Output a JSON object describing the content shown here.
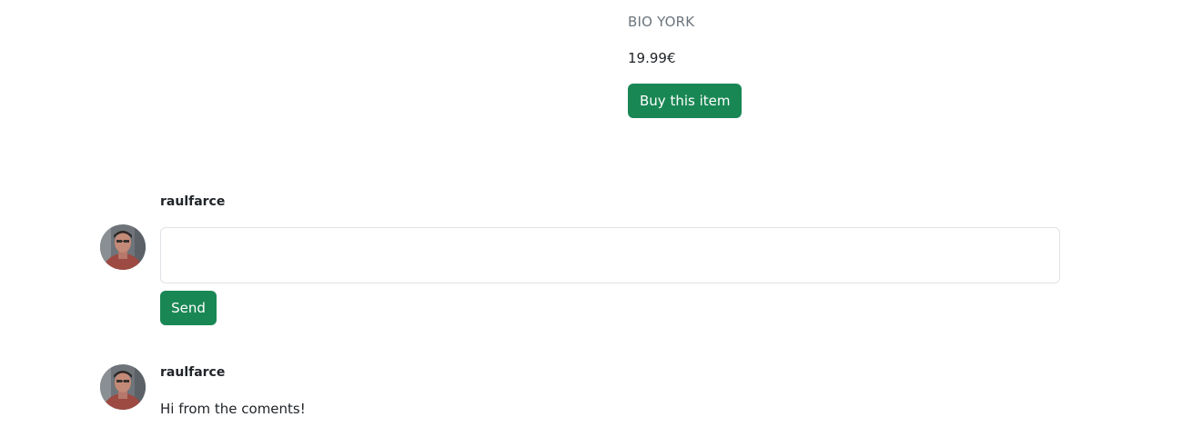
{
  "product": {
    "brand": "BIO YORK",
    "price": "19.99€",
    "buy_label": "Buy this item"
  },
  "comment_form": {
    "username": "raulfarce",
    "input_value": "",
    "send_label": "Send"
  },
  "comments": [
    {
      "username": "raulfarce",
      "text": "Hi from the coments!"
    }
  ],
  "colors": {
    "primary_button": "#198754",
    "brand_text": "#6c757d",
    "input_border": "#dee2e6"
  }
}
